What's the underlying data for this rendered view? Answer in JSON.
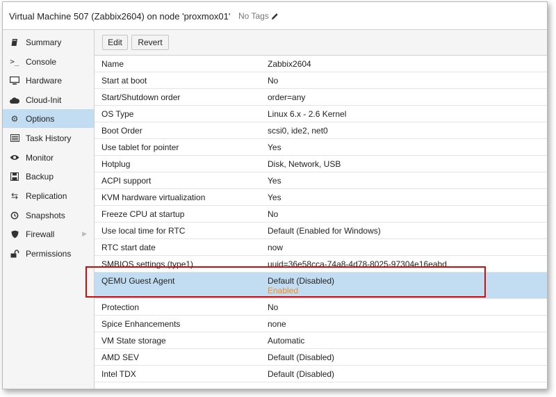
{
  "header": {
    "title": "Virtual Machine 507 (Zabbix2604) on node 'proxmox01'",
    "tags_label": "No Tags"
  },
  "sidebar": {
    "items": [
      {
        "label": "Summary",
        "icon": "book-icon"
      },
      {
        "label": "Console",
        "icon": "terminal-icon"
      },
      {
        "label": "Hardware",
        "icon": "monitor-icon"
      },
      {
        "label": "Cloud-Init",
        "icon": "cloud-icon"
      },
      {
        "label": "Options",
        "icon": "gear-icon",
        "active": true
      },
      {
        "label": "Task History",
        "icon": "list-icon"
      },
      {
        "label": "Monitor",
        "icon": "eye-icon"
      },
      {
        "label": "Backup",
        "icon": "floppy-icon"
      },
      {
        "label": "Replication",
        "icon": "retweet-icon"
      },
      {
        "label": "Snapshots",
        "icon": "history-icon"
      },
      {
        "label": "Firewall",
        "icon": "shield-icon"
      },
      {
        "label": "Permissions",
        "icon": "unlock-icon"
      }
    ]
  },
  "toolbar": {
    "edit_label": "Edit",
    "revert_label": "Revert"
  },
  "options": [
    {
      "key": "Name",
      "value": "Zabbix2604"
    },
    {
      "key": "Start at boot",
      "value": "No"
    },
    {
      "key": "Start/Shutdown order",
      "value": "order=any"
    },
    {
      "key": "OS Type",
      "value": "Linux 6.x - 2.6 Kernel"
    },
    {
      "key": "Boot Order",
      "value": "scsi0, ide2, net0"
    },
    {
      "key": "Use tablet for pointer",
      "value": "Yes"
    },
    {
      "key": "Hotplug",
      "value": "Disk, Network, USB"
    },
    {
      "key": "ACPI support",
      "value": "Yes"
    },
    {
      "key": "KVM hardware virtualization",
      "value": "Yes"
    },
    {
      "key": "Freeze CPU at startup",
      "value": "No"
    },
    {
      "key": "Use local time for RTC",
      "value": "Default (Enabled for Windows)"
    },
    {
      "key": "RTC start date",
      "value": "now"
    },
    {
      "key": "SMBIOS settings (type1)",
      "value": "uuid=36e58cca-74a8-4d78-8025-97304e16eabd"
    },
    {
      "key": "QEMU Guest Agent",
      "value": "Default (Disabled)",
      "pending": "Enabled",
      "selected": true
    },
    {
      "key": "Protection",
      "value": "No"
    },
    {
      "key": "Spice Enhancements",
      "value": "none"
    },
    {
      "key": "VM State storage",
      "value": "Automatic"
    },
    {
      "key": "AMD SEV",
      "value": "Default (Disabled)"
    },
    {
      "key": "Intel TDX",
      "value": "Default (Disabled)"
    }
  ],
  "colors": {
    "selection": "#c2ddf2",
    "pending": "#f08a1d",
    "highlight_border": "#d10a0a"
  }
}
